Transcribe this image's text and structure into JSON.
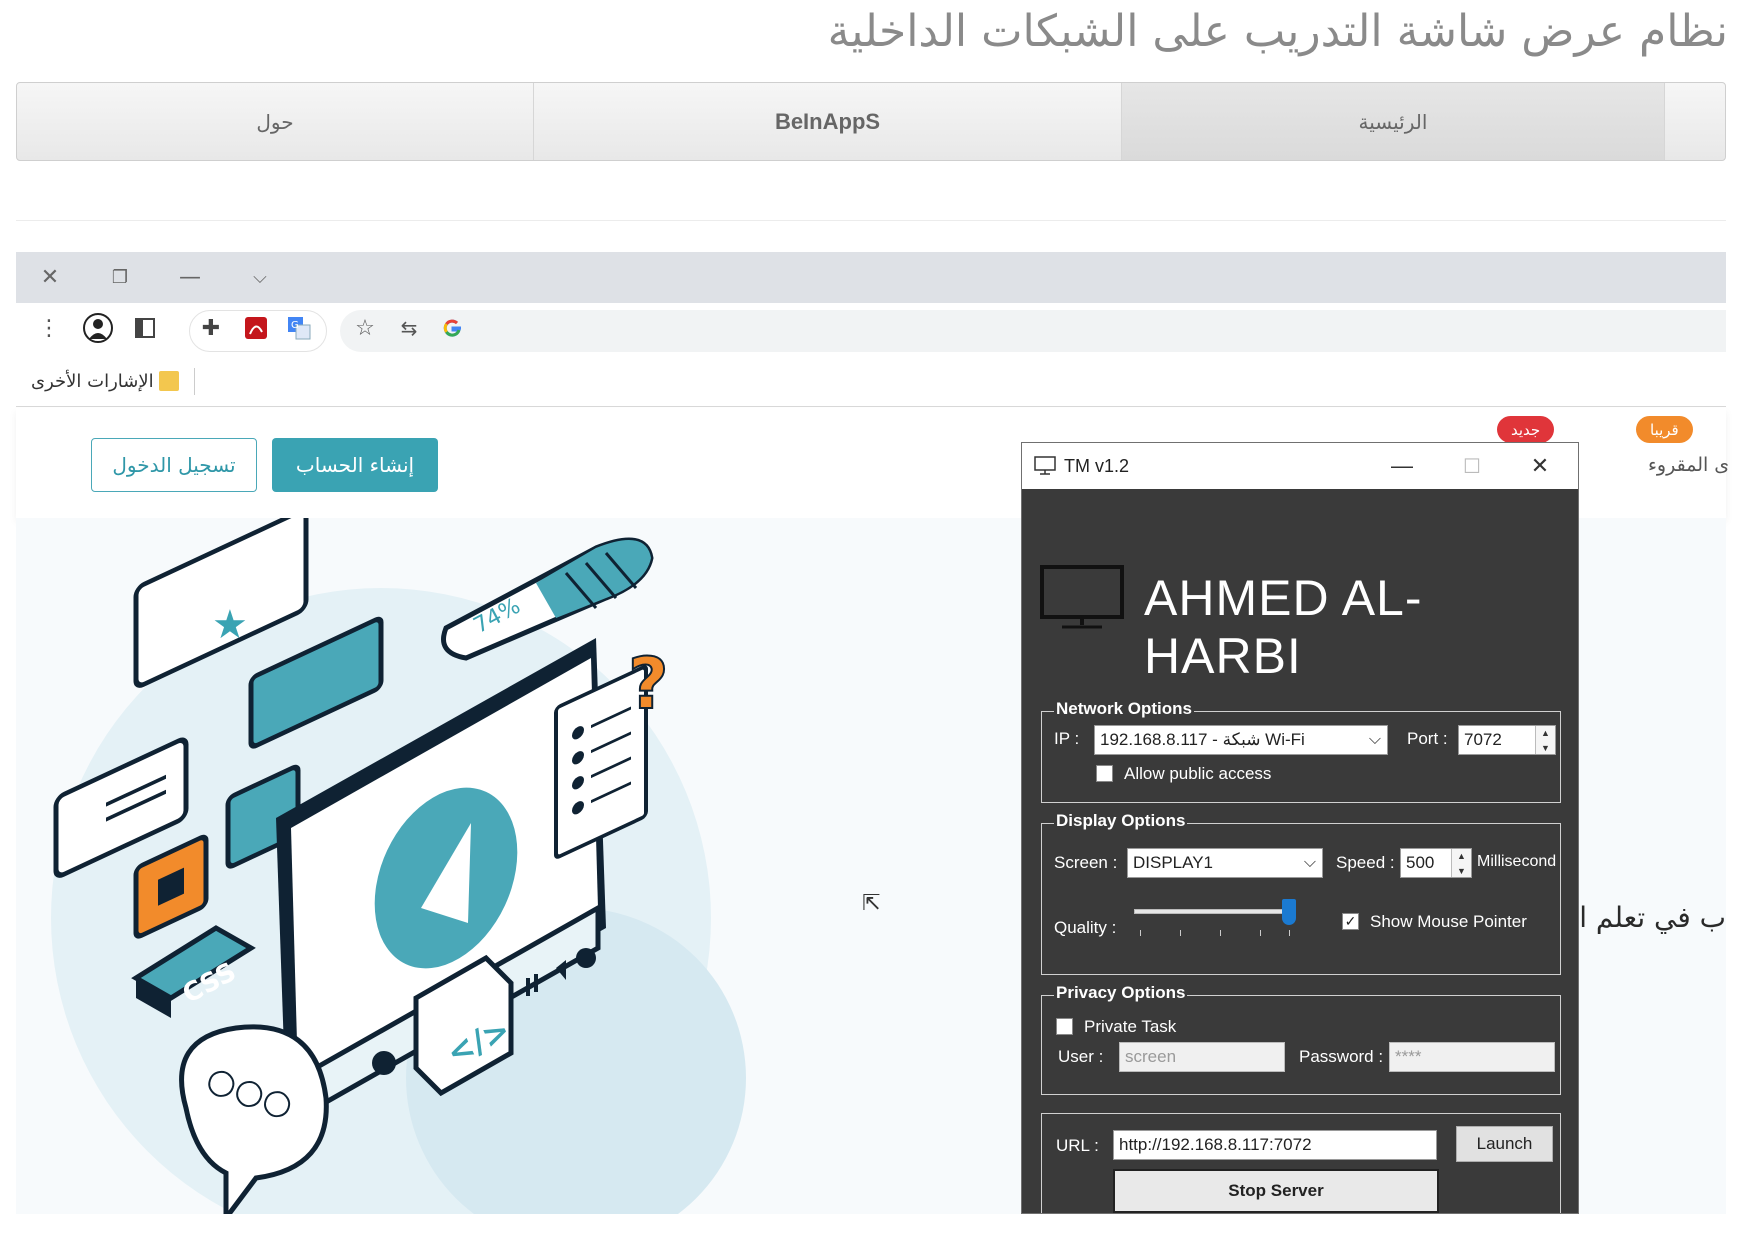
{
  "page_title": "نظام عرض شاشة التدريب على الشبكات الداخلية",
  "topnav": {
    "about": "حول",
    "apps": "BeInAppS",
    "home": "الرئيسية"
  },
  "browser": {
    "window_controls": [
      "close-icon",
      "restore-icon",
      "minimize-icon",
      "chevron-down-icon"
    ],
    "toolbar_icons": [
      "menu-icon",
      "profile-icon",
      "sidebar-icon",
      "extensions-icon",
      "pdf-icon",
      "translate-icon",
      "star-icon",
      "share-icon",
      "google-icon"
    ],
    "bookmarks_label": "الإشارات الأخرى"
  },
  "site": {
    "login_button": "تسجيل الدخول",
    "signup_button": "إنشاء الحساب",
    "badge_new": "جديد",
    "badge_soon": "قريبا",
    "partial_nav_text": "ى المقروء",
    "hero_partial": "ب في تعلم البر",
    "illustration_percent": "74%",
    "illustration_css": "CSS",
    "illustration_code": "</>",
    "illustration_question": "?",
    "illustration_star": "★",
    "illustration_dots": "○○○"
  },
  "tm": {
    "window_title": "TM v1.2",
    "brand": "AHMED AL-HARBI",
    "network": {
      "title": "Network Options",
      "ip_label": "IP :",
      "ip_value": "192.168.8.117 - شبكة Wi-Fi",
      "port_label": "Port :",
      "port_value": "7072",
      "allow_public": "Allow public access",
      "allow_public_checked": false
    },
    "display": {
      "title": "Display Options",
      "screen_label": "Screen :",
      "screen_value": "DISPLAY1",
      "speed_label": "Speed :",
      "speed_value": "500",
      "speed_unit": "Millisecond",
      "quality_label": "Quality :",
      "quality_level": 1.0,
      "show_pointer": "Show Mouse Pointer",
      "show_pointer_checked": true
    },
    "privacy": {
      "title": "Privacy Options",
      "private_task": "Private Task",
      "private_task_checked": false,
      "user_label": "User :",
      "user_value": "screen",
      "password_label": "Password :",
      "password_value": "****"
    },
    "url_label": "URL :",
    "url_value": "http://192.168.8.117:7072",
    "launch_button": "Launch",
    "stop_button": "Stop Server"
  },
  "colors": {
    "teal": "#3aa3b3",
    "dark": "#0f2233",
    "orange": "#f28b2b",
    "red_badge": "#e0353a",
    "tm_bg": "#3a3a3a"
  }
}
